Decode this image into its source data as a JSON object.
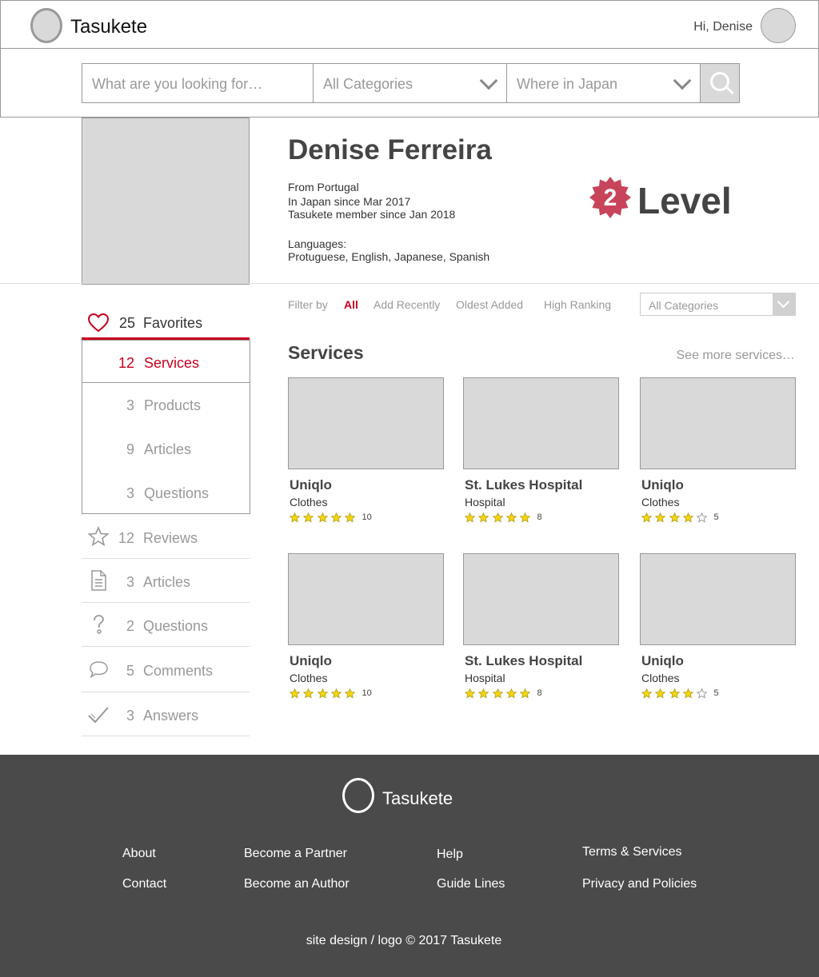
{
  "header": {
    "brand": "Tasukete",
    "greeting": "Hi, Denise"
  },
  "search": {
    "query_placeholder": "What are you looking for…",
    "category_value": "All Categories",
    "location_value": "Where in Japan"
  },
  "profile": {
    "name": "Denise Ferreira",
    "from": "From Portugal",
    "in_japan": "In Japan since Mar 2017",
    "member": "Tasukete member since Jan 2018",
    "languages_label": "Languages:",
    "languages": "Protuguese, English, Japanese, Spanish",
    "level_number": "2",
    "level_label": "Level"
  },
  "sidebar": {
    "favorites": {
      "count": "25",
      "label": "Favorites"
    },
    "favorite_subitems": [
      {
        "count": "12",
        "label": "Services"
      },
      {
        "count": "3",
        "label": "Products"
      },
      {
        "count": "9",
        "label": "Articles"
      },
      {
        "count": "3",
        "label": "Questions"
      }
    ],
    "items": [
      {
        "count": "12",
        "label": "Reviews",
        "icon": "star-icon"
      },
      {
        "count": "3",
        "label": "Articles",
        "icon": "document-icon"
      },
      {
        "count": "2",
        "label": "Questions",
        "icon": "question-icon"
      },
      {
        "count": "5",
        "label": "Comments",
        "icon": "comment-icon"
      },
      {
        "count": "3",
        "label": "Answers",
        "icon": "checkmark-icon"
      }
    ]
  },
  "filter": {
    "label": "Filter by",
    "options": [
      "All",
      "Add Recently",
      "Oldest Added",
      "High Ranking"
    ],
    "category_value": "All Categories"
  },
  "services": {
    "title": "Services",
    "see_more": "See more services…",
    "cards": [
      {
        "title": "Uniqlo",
        "category": "Clothes",
        "rating": 5,
        "count": "10"
      },
      {
        "title": "St. Lukes Hospital",
        "category": "Hospital",
        "rating": 5,
        "count": "8"
      },
      {
        "title": "Uniqlo",
        "category": "Clothes",
        "rating": 4,
        "count": "5"
      },
      {
        "title": "Uniqlo",
        "category": "Clothes",
        "rating": 5,
        "count": "10"
      },
      {
        "title": "St. Lukes Hospital",
        "category": "Hospital",
        "rating": 5,
        "count": "8"
      },
      {
        "title": "Uniqlo",
        "category": "Clothes",
        "rating": 4,
        "count": "5"
      }
    ]
  },
  "footer": {
    "brand": "Tasukete",
    "links": [
      "About",
      "Contact",
      "Become a Partner",
      "Become an Author",
      "Help",
      "Guide Lines",
      "Terms & Services",
      "Privacy and Policies"
    ],
    "copyright": "site design / logo © 2017 Tasukete"
  },
  "colors": {
    "accent": "#c8001e",
    "footer_bg": "#4a4a4a",
    "placeholder_gray": "#d9d9d9",
    "star_fill": "#f5d60c",
    "badge": "#c8445a"
  }
}
